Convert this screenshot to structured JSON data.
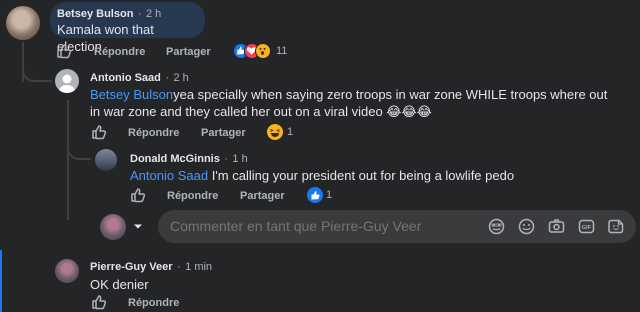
{
  "comments": [
    {
      "author": "Betsey Bulson",
      "time": "2 h",
      "text": "Kamala won that election",
      "reply_label": "Répondre",
      "share_label": "Partager",
      "reaction_count": "11",
      "reactions": [
        "like",
        "love",
        "wow"
      ]
    },
    {
      "author": "Antonio Saad",
      "time": "2 h",
      "mention": "Betsey Bulson",
      "text": "yea specially when saying zero troops in war zone WHILE troops where out in war zone and they called her out on a viral video 😂😂😂",
      "text_line1": "yea specially when saying zero troops in war zone WHILE troops where out",
      "text_line2": "in war zone and they called her out on a viral video 😂😂😂",
      "reply_label": "Répondre",
      "share_label": "Partager",
      "reaction_count": "1",
      "reactions": [
        "haha"
      ]
    },
    {
      "author": "Donald McGinnis",
      "time": "1 h",
      "mention": "Antonio Saad",
      "text": " I'm calling your president out for being a lowlife pedo",
      "reply_label": "Répondre",
      "share_label": "Partager",
      "reaction_count": "1",
      "reactions": [
        "like"
      ]
    },
    {
      "author": "Pierre-Guy Veer",
      "time": "1 min",
      "text": "OK denier",
      "reply_label": "Répondre"
    }
  ],
  "composer": {
    "placeholder": "Commenter en tant que Pierre-Guy Veer",
    "icons": [
      "avatar-icon",
      "sticker-icon",
      "emoji-icon",
      "camera-icon",
      "gif-icon",
      "sticker-square-icon"
    ]
  },
  "separator": "·",
  "colors": {
    "background": "#242526",
    "bubble": "#3a3b3c",
    "bubble_highlight": "#263951",
    "mention": "#4599ff",
    "like_blue": "#1877f2",
    "love_red": "#f33e58",
    "wow_yellow": "#f7b125"
  }
}
